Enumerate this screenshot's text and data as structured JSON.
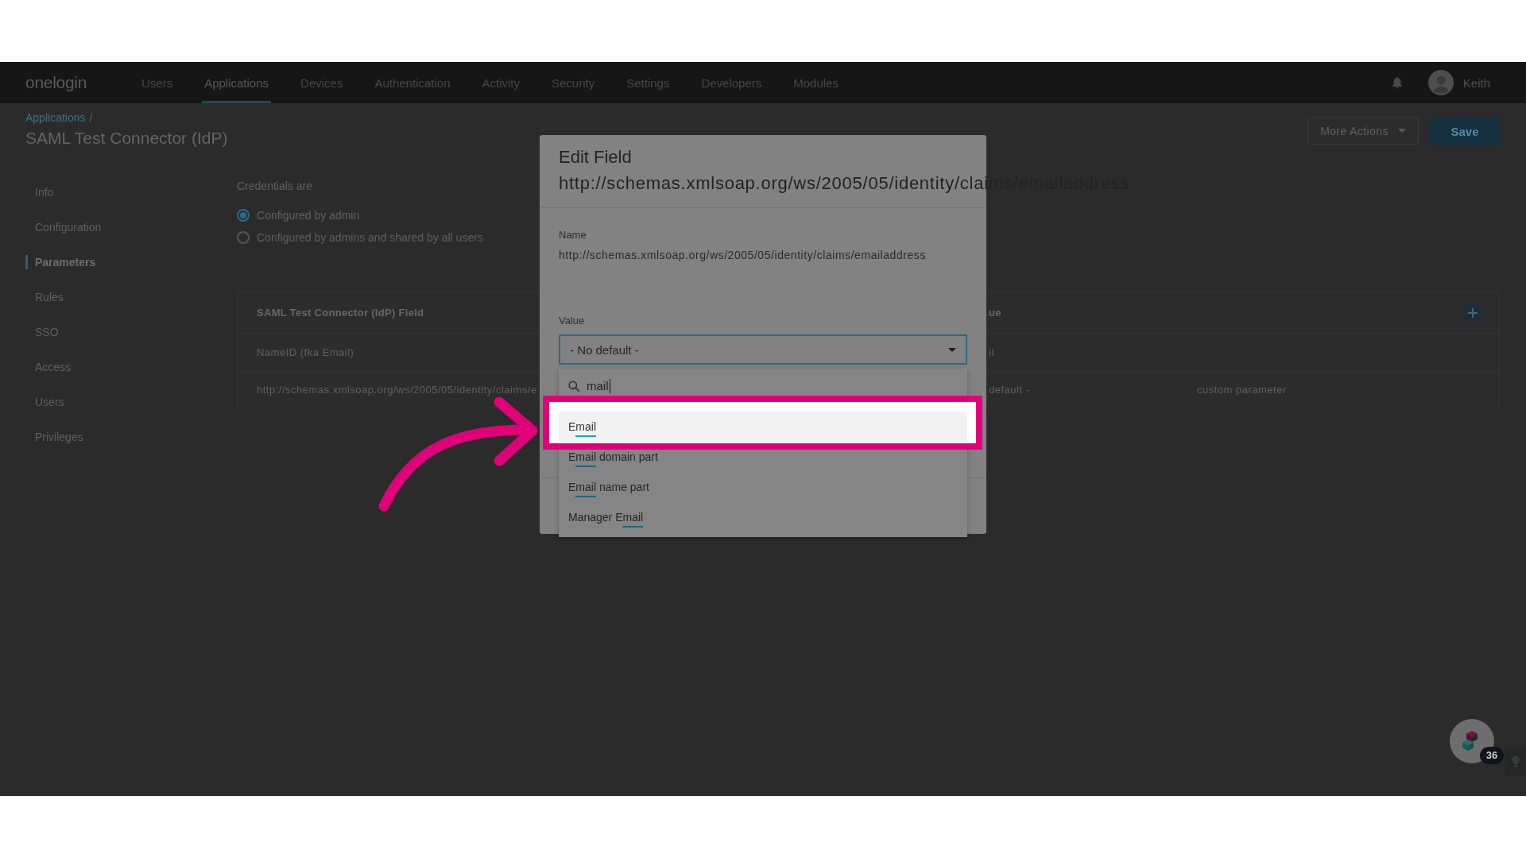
{
  "nav": {
    "logo": "onelogin",
    "items": [
      {
        "label": "Users",
        "selected": false
      },
      {
        "label": "Applications",
        "selected": true
      },
      {
        "label": "Devices",
        "selected": false
      },
      {
        "label": "Authentication",
        "selected": false
      },
      {
        "label": "Activity",
        "selected": false
      },
      {
        "label": "Security",
        "selected": false
      },
      {
        "label": "Settings",
        "selected": false
      },
      {
        "label": "Developers",
        "selected": false
      },
      {
        "label": "Modules",
        "selected": false
      }
    ],
    "user": "Keith"
  },
  "header": {
    "breadcrumb": {
      "link": "Applications",
      "separator": "/"
    },
    "title": "SAML Test Connector (IdP)",
    "actions": [
      {
        "label": "More Actions",
        "kind": "menu"
      },
      {
        "label": "Save",
        "kind": "primary"
      }
    ]
  },
  "sidebar": {
    "items": [
      {
        "label": "Info",
        "selected": false
      },
      {
        "label": "Configuration",
        "selected": false
      },
      {
        "label": "Parameters",
        "selected": true
      },
      {
        "label": "Rules",
        "selected": false
      },
      {
        "label": "SSO",
        "selected": false
      },
      {
        "label": "Access",
        "selected": false
      },
      {
        "label": "Users",
        "selected": false
      },
      {
        "label": "Privileges",
        "selected": false
      }
    ]
  },
  "credentials": {
    "label": "Credentials are",
    "options": [
      {
        "label": "Configured by admin",
        "selected": true
      },
      {
        "label": "Configured by admins and shared by all users",
        "selected": false
      }
    ]
  },
  "table": {
    "columns": [
      "SAML Test Connector (IdP) Field",
      "ue"
    ],
    "rows": [
      [
        "NameID (fka Email)",
        "il"
      ],
      [
        "http://schemas.xmlsoap.org/ws/2005/05/identity/claims/e",
        "default -",
        "custom parameter"
      ]
    ]
  },
  "modal": {
    "title": "Edit Field",
    "subtitle": "http://schemas.xmlsoap.org/ws/2005/05/identity/claims/emailaddress",
    "name": {
      "label": "Name",
      "value": "http://schemas.xmlsoap.org/ws/2005/05/identity/claims/emailaddress"
    },
    "value": {
      "label": "Value",
      "select": "- No default -",
      "expanded": true,
      "search": "mail",
      "options": [
        {
          "prefix": "E",
          "match": "mail",
          "selected": true
        },
        {
          "prefix": "E",
          "match": "mail",
          "suffix": " domain part",
          "selected": false
        },
        {
          "prefix": "E",
          "match": "mail",
          "suffix": " name part",
          "selected": false
        },
        {
          "prefix": "Manager E",
          "match": "mail",
          "selected": false
        }
      ]
    }
  },
  "help": {
    "badge": "36"
  }
}
